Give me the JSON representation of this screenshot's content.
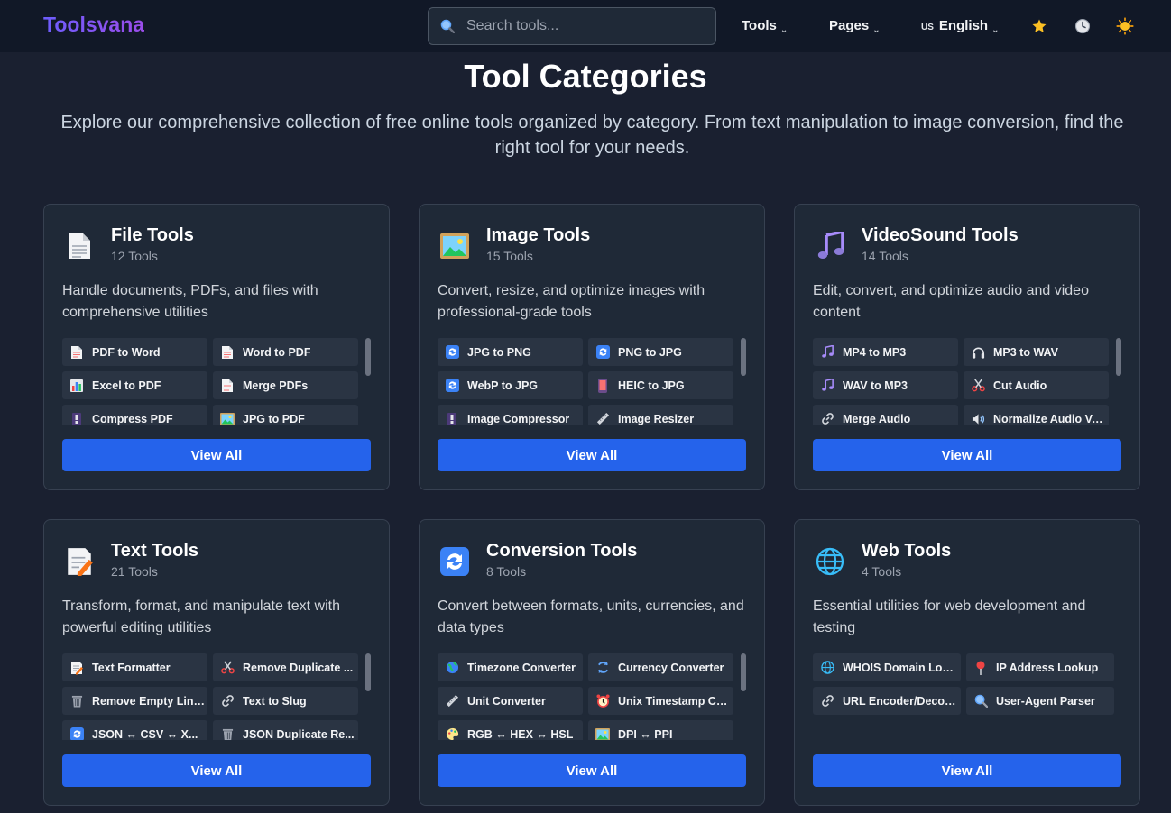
{
  "header": {
    "logo": "Toolsvana",
    "search_placeholder": "Search tools...",
    "nav": {
      "tools": "Tools",
      "pages": "Pages",
      "language_flag": "US",
      "language": "English"
    },
    "icons": [
      "star-icon",
      "history-icon",
      "sun-icon"
    ]
  },
  "hero": {
    "title": "Tool Categories",
    "subtitle": "Explore our comprehensive collection of free online tools organized by category. From text manipulation to image conversion, find the right tool for your needs."
  },
  "categories": [
    {
      "title": "File Tools",
      "count": "12 Tools",
      "icon": "document-icon",
      "description": "Handle documents, PDFs, and files with comprehensive utilities",
      "tools": [
        {
          "label": "PDF to Word",
          "icon": "page-icon"
        },
        {
          "label": "Word to PDF",
          "icon": "page-icon"
        },
        {
          "label": "Excel to PDF",
          "icon": "bar-chart-icon"
        },
        {
          "label": "Merge PDFs",
          "icon": "page-icon"
        },
        {
          "label": "Compress PDF",
          "icon": "compress-icon"
        },
        {
          "label": "JPG to PDF",
          "icon": "picture-icon"
        }
      ],
      "button": "View All"
    },
    {
      "title": "Image Tools",
      "count": "15 Tools",
      "icon": "picture-icon",
      "description": "Convert, resize, and optimize images with professional-grade tools",
      "tools": [
        {
          "label": "JPG to PNG",
          "icon": "convert-icon"
        },
        {
          "label": "PNG to JPG",
          "icon": "convert-icon"
        },
        {
          "label": "WebP to JPG",
          "icon": "convert-icon"
        },
        {
          "label": "HEIC to JPG",
          "icon": "phone-icon"
        },
        {
          "label": "Image Compressor",
          "icon": "compress-icon"
        },
        {
          "label": "Image Resizer",
          "icon": "ruler-icon"
        }
      ],
      "button": "View All"
    },
    {
      "title": "VideoSound Tools",
      "count": "14 Tools",
      "icon": "music-icon",
      "description": "Edit, convert, and optimize audio and video content",
      "tools": [
        {
          "label": "MP4 to MP3",
          "icon": "music-icon"
        },
        {
          "label": "MP3 to WAV",
          "icon": "headphones-icon"
        },
        {
          "label": "WAV to MP3",
          "icon": "music-icon"
        },
        {
          "label": "Cut Audio",
          "icon": "scissors-icon"
        },
        {
          "label": "Merge Audio",
          "icon": "link-icon"
        },
        {
          "label": "Normalize Audio Vo...",
          "icon": "speaker-icon"
        }
      ],
      "button": "View All"
    },
    {
      "title": "Text Tools",
      "count": "21 Tools",
      "icon": "memo-icon",
      "description": "Transform, format, and manipulate text with powerful editing utilities",
      "tools": [
        {
          "label": "Text Formatter",
          "icon": "memo-icon"
        },
        {
          "label": "Remove Duplicate ...",
          "icon": "scissors-icon"
        },
        {
          "label": "Remove Empty Lines",
          "icon": "trash-icon"
        },
        {
          "label": "Text to Slug",
          "icon": "link-icon"
        },
        {
          "label": "JSON ↔ CSV ↔ X...",
          "icon": "convert-icon"
        },
        {
          "label": "JSON Duplicate Re...",
          "icon": "trash-icon"
        }
      ],
      "button": "View All"
    },
    {
      "title": "Conversion Tools",
      "count": "8 Tools",
      "icon": "convert-icon",
      "description": "Convert between formats, units, currencies, and data types",
      "tools": [
        {
          "label": "Timezone Converter",
          "icon": "globe-icon"
        },
        {
          "label": "Currency Converter",
          "icon": "cycle-icon"
        },
        {
          "label": "Unit Converter",
          "icon": "ruler-icon"
        },
        {
          "label": "Unix Timestamp Co...",
          "icon": "alarm-icon"
        },
        {
          "label": "RGB ↔ HEX ↔ HSL",
          "icon": "palette-icon"
        },
        {
          "label": "DPI ↔ PPI",
          "icon": "picture-icon"
        }
      ],
      "button": "View All"
    },
    {
      "title": "Web Tools",
      "count": "4 Tools",
      "icon": "globe-icon",
      "description": "Essential utilities for web development and testing",
      "tools": [
        {
          "label": "WHOIS Domain Loo...",
          "icon": "globe-icon"
        },
        {
          "label": "IP Address Lookup",
          "icon": "pin-icon"
        },
        {
          "label": "URL Encoder/Decod...",
          "icon": "link-icon"
        },
        {
          "label": "User-Agent Parser",
          "icon": "search-icon"
        }
      ],
      "button": "View All"
    }
  ]
}
